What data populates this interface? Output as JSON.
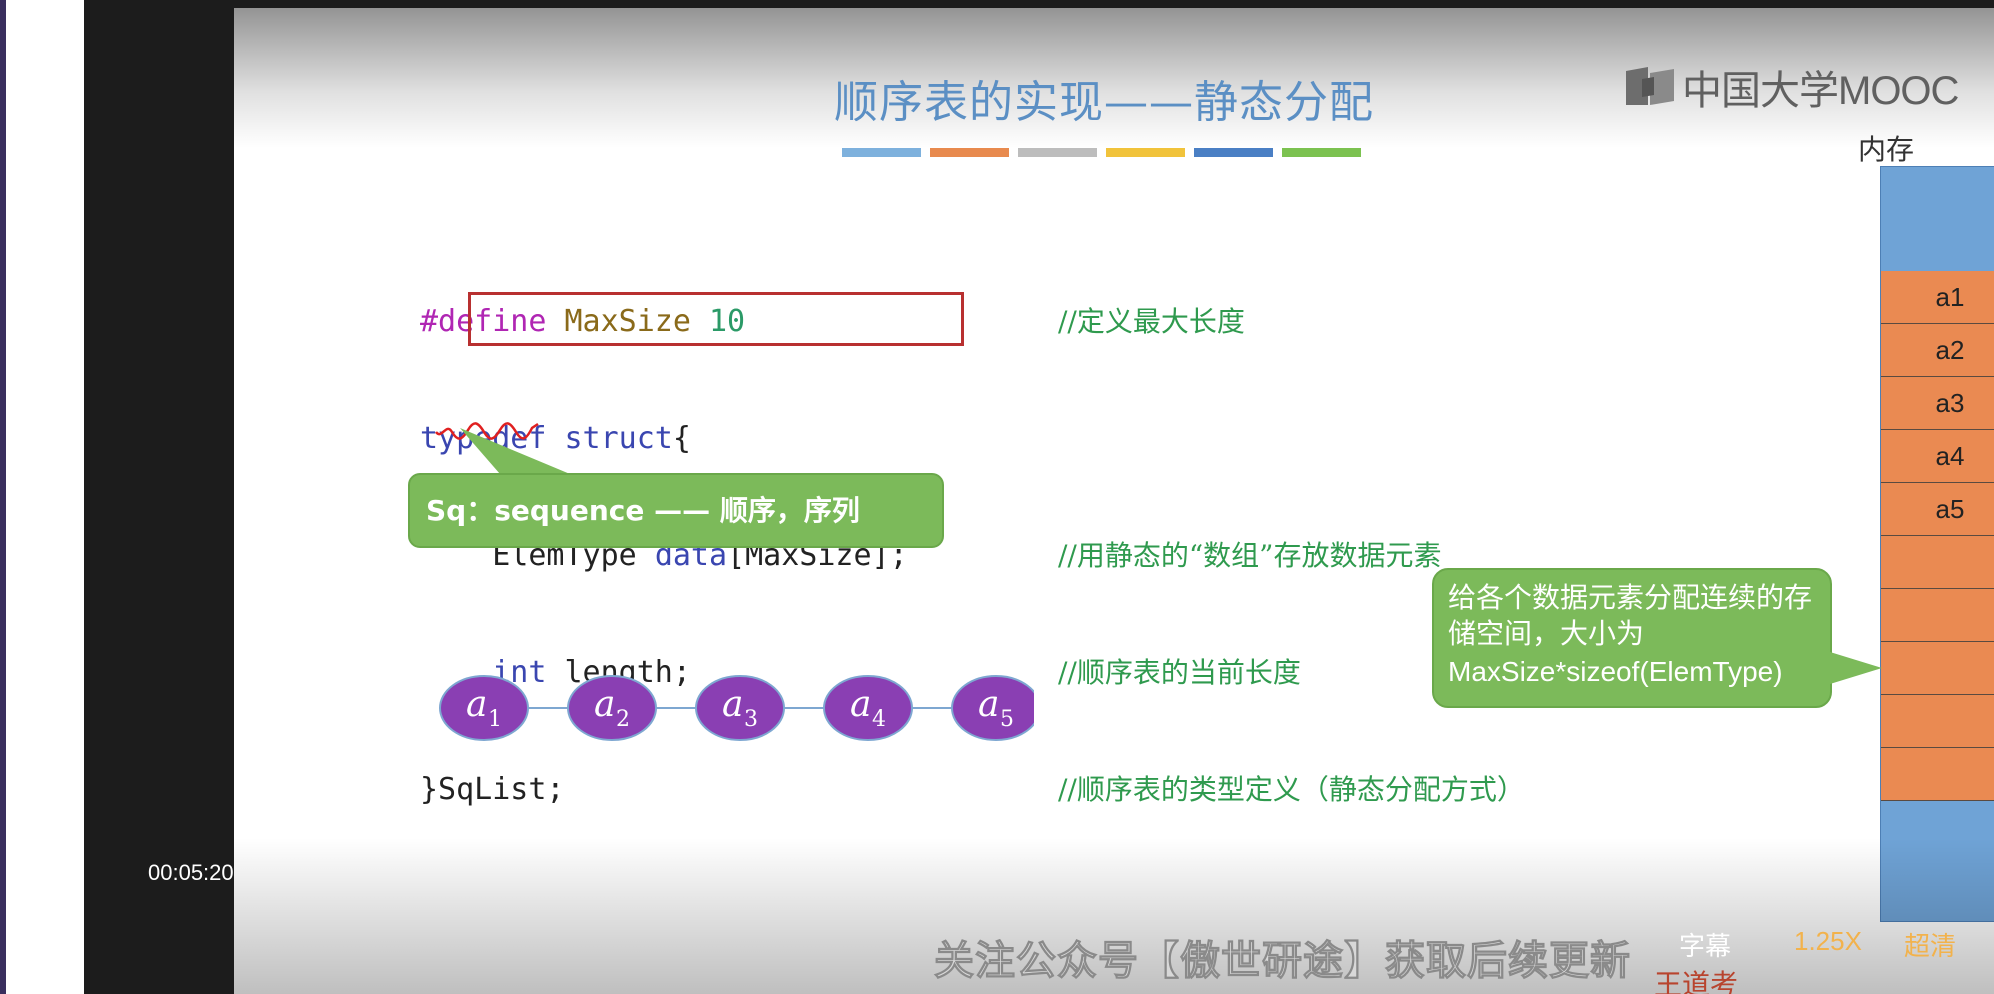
{
  "video": {
    "timestamp": "00:05:20",
    "subtitle_label": "字幕",
    "speed_label": "1.25X",
    "quality_label": "超清",
    "watermark_text": "关注公众号【傲世研途】获取后续更新",
    "site_watermark": "王道考研/CSKAOYAN.COM"
  },
  "slide": {
    "title": "顺序表的实现——静态分配",
    "logo_text": "中国大学MOOC",
    "title_bar_colors": [
      "#7eb1dd",
      "#e88a4e",
      "#bdbdbd",
      "#f1c33b",
      "#4a7fc4",
      "#7cc250"
    ],
    "code": {
      "line1": {
        "kw": "#define",
        "name": "MaxSize",
        "num": "10"
      },
      "line2": {
        "kw1": "typedef",
        "kw2": "struct",
        "rest": "{"
      },
      "line3": {
        "type": "ElemType",
        "field": "data",
        "rest": "[MaxSize];"
      },
      "line4": {
        "kw": "int",
        "rest": "length;"
      },
      "line5": {
        "text": "}SqList;"
      }
    },
    "comments": [
      "//定义最大长度",
      "//用静态的“数组”存放数据元素",
      "//顺序表的当前长度",
      "//顺序表的类型定义（静态分配方式）"
    ],
    "callout_sq": "Sq：sequence —— 顺序，序列",
    "nodes": [
      "a",
      "a",
      "a",
      "a",
      "a"
    ],
    "node_subs": [
      "1",
      "2",
      "3",
      "4",
      "5"
    ],
    "memory_label": "内存",
    "memory_cells": [
      "a1",
      "a2",
      "a3",
      "a4",
      "a5",
      "",
      "",
      "",
      "",
      ""
    ],
    "callout_mem_text": "给各个数据元素分配连续的存储空间，大小为",
    "callout_mem_formula": "MaxSize*sizeof(ElemType)",
    "colors": {
      "node_fill": "#8a3fb3",
      "callout_green": "#7cba5a",
      "memory_orange": "#ea8a52",
      "memory_blue": "#6fa3d6",
      "highlight_red": "#b83030"
    }
  }
}
